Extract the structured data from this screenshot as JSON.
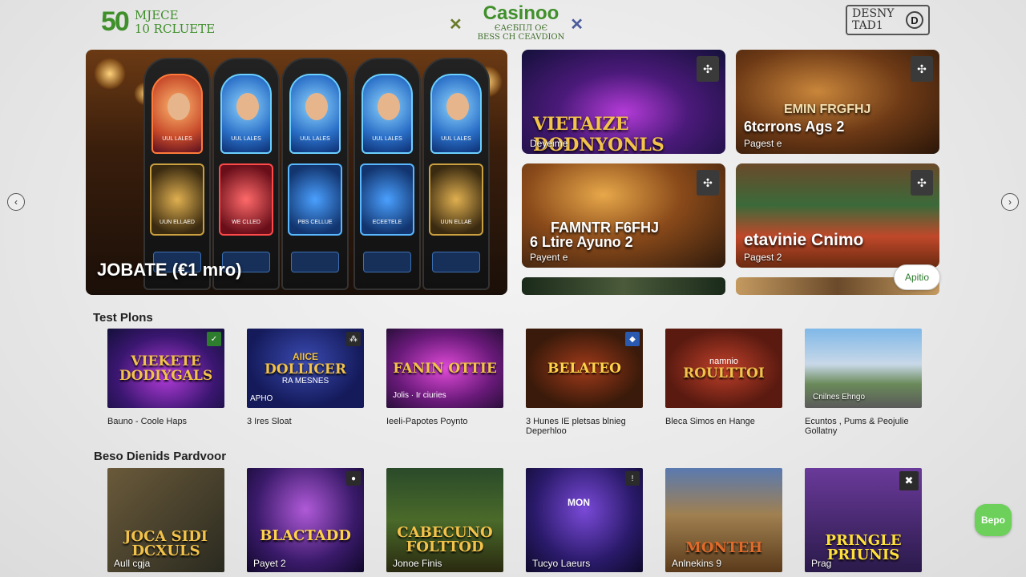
{
  "header": {
    "logo_left_number": "50",
    "logo_left_line1": "MJECE",
    "logo_left_line2": "10 RCLUETE",
    "center_title": "Casinoo",
    "center_sub1": "ЄАЄБПЛ ОЄ",
    "center_sub2": "BESS CH CEAVDION",
    "logo_right_line1": "DESNY",
    "logo_right_line2": "TAD1",
    "logo_right_mark": "D"
  },
  "hero": {
    "caption": "JOBATE (€1 mro)",
    "machines": [
      {
        "top_label": "UUL LALES",
        "mid_label": "UUN ELLAED"
      },
      {
        "top_label": "UUL LALES",
        "mid_label": "WE CLLED"
      },
      {
        "top_label": "UUL LALES",
        "mid_label": "PBS CELLUE"
      },
      {
        "top_label": "UUL LALES",
        "mid_label": "ECEETELE"
      },
      {
        "top_label": "UUL LALES",
        "mid_label": "UUN ELLAE"
      }
    ]
  },
  "features": [
    {
      "title": "VIETAIZE DODNYONLS",
      "subtitle": "Deyeime"
    },
    {
      "title": "6tcrrons Ags 2",
      "subtitle": "Pagest e",
      "banner": "EMIN FRGFHJ"
    },
    {
      "title": "6 Ltire Ayuno 2",
      "subtitle": "Payent e",
      "banner": "FAMNTR F6FHJ"
    },
    {
      "title": "etavinie Cnimo",
      "subtitle": "Pagest 2"
    }
  ],
  "apply_label": "Apitio",
  "sections": [
    {
      "title": "Test Plons",
      "cards": [
        {
          "name": "VIEKETE DODIYGALS",
          "caption": "Bauno - Coole Haps"
        },
        {
          "name": "DOLLICER",
          "overlay_top": "AIICE",
          "overlay_bottom": "RA MESNES",
          "overlay_tag": "APHO",
          "caption": "3 Ires Sloat"
        },
        {
          "name": "FANIN OTTIE",
          "overlay_bottom": "Jolis · Ir ciuries",
          "caption": "Ieeli-Papotes Poynto"
        },
        {
          "name": "BELATEO",
          "caption": "3 Hunes IE pletsas blnieg Deperhloo"
        },
        {
          "name": "ROULTTOI",
          "overlay_top": "namnio",
          "caption": "Bleca Simos en Hange"
        },
        {
          "name": "",
          "overlay_bottom": "Cnilnes Ehngo",
          "caption": "Ecuntos , Pums & Peojulie Gollatny"
        }
      ]
    },
    {
      "title": "Beso Dienids Pardvoor",
      "cards": [
        {
          "name": "JOCA SIDI DCXULS",
          "label": "Aull cgja"
        },
        {
          "name": "BLACTADD",
          "label": "Payet 2"
        },
        {
          "name": "CABECUNO FOLTTOD",
          "label": "Jonoe Finis"
        },
        {
          "name": "",
          "overlay_top": "MON",
          "label": "Tucyo Laeurs"
        },
        {
          "name": "MONTEH",
          "label": "Anlnekins 9"
        },
        {
          "name": "PRINGLE PRIUNIS",
          "label": "Prag"
        }
      ]
    }
  ],
  "depo_label": "Bepo",
  "colors": {
    "brand_green": "#3f8f2a",
    "cta_green": "#6cd05a"
  }
}
